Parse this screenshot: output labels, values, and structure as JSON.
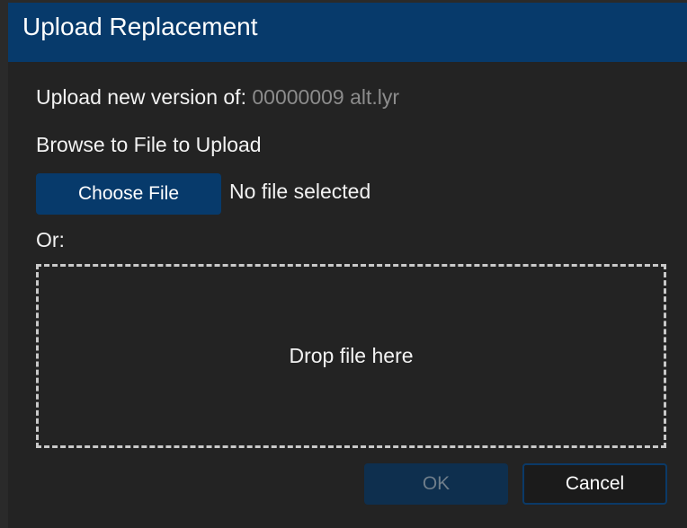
{
  "dialog": {
    "title": "Upload Replacement",
    "upload_label": "Upload new version of:",
    "filename": "00000009 alt.lyr",
    "browse_label": "Browse to File to Upload",
    "choose_file_label": "Choose File",
    "no_file_text": "No file selected",
    "or_label": "Or:",
    "drop_text": "Drop file here",
    "ok_label": "OK",
    "cancel_label": "Cancel"
  },
  "colors": {
    "title_bar": "#073a6b",
    "background": "#232323",
    "muted_text": "#8c8c8c"
  }
}
